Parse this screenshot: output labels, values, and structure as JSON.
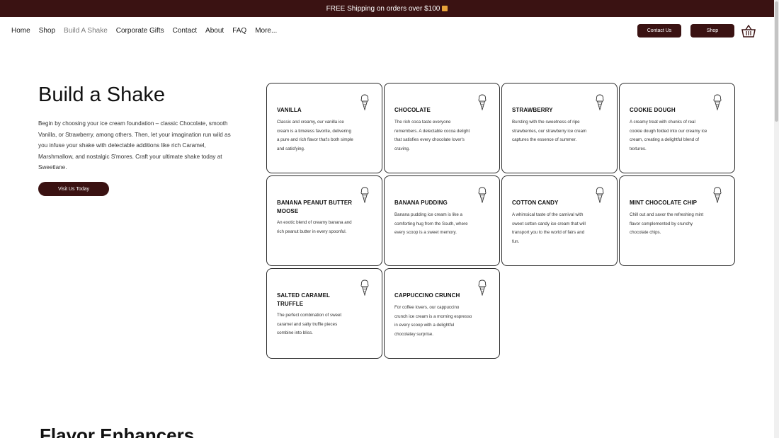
{
  "announcement": "FREE Shipping on orders over $100",
  "nav": {
    "items": [
      {
        "label": "Home",
        "active": false
      },
      {
        "label": "Shop",
        "active": false
      },
      {
        "label": "Build A Shake",
        "active": true
      },
      {
        "label": "Corporate Gifts",
        "active": false
      },
      {
        "label": "Contact",
        "active": false
      },
      {
        "label": "About",
        "active": false
      },
      {
        "label": "FAQ",
        "active": false
      },
      {
        "label": "More...",
        "active": false
      }
    ],
    "contact_label": "Contact Us",
    "shop_label": "Shop"
  },
  "hero": {
    "title": "Build a Shake",
    "text": "Begin by choosing your ice cream foundation – classic Chocolate, smooth Vanilla, or Strawberry, among others. Then, let your imagination run wild as you infuse your shake with delectable additions like rich Caramel, Marshmallow, and nostalgic S'mores. Craft your ultimate shake today at Sweetlane.",
    "button_label": "Visit Us Today"
  },
  "flavors": [
    {
      "title": "VANILLA",
      "desc": "Classic and creamy, our vanilla ice cream is a timeless favorite, delivering a pure and rich flavor that's both simple and satisfying."
    },
    {
      "title": "CHOCOLATE",
      "desc": "The rich coca taste everyone remembers. A delectable cocoa delight that satisfies every chocolate lover's craving."
    },
    {
      "title": "STRAWBERRY",
      "desc": "Bursting with the sweetness of ripe strawberries, our strawberry ice cream captures the essence of summer."
    },
    {
      "title": "COOKIE DOUGH",
      "desc": "A creamy treat with chunks of real cookie dough folded into our creamy ice cream, creating a delightful blend of textures."
    },
    {
      "title": "BANANA PEANUT BUTTER MOOSE",
      "desc": "An exotic blend of creamy banana and rich peanut butter in every spoonful."
    },
    {
      "title": "BANANA PUDDING",
      "desc": "Banana pudding ice cream is like a comforting hug from the South, where every scoop is a sweet memory."
    },
    {
      "title": "COTTON CANDY",
      "desc": "A whimsical taste of the carnival with sweet cotton candy ice cream that will transport you to the world of fairs and fun."
    },
    {
      "title": "MINT CHOCOLATE CHIP",
      "desc": "Chill out and savor the refreshing mint flavor complemented by crunchy chocolate chips."
    },
    {
      "title": "SALTED CARAMEL TRUFFLE",
      "desc": "The perfect combination of sweet caramel and salty truffle pieces combine into bliss."
    },
    {
      "title": "CAPPUCCINO CRUNCH",
      "desc": "For coffee lovers, our cappuccino crunch ice cream is a morning espresso in every scoop with a delightful chocolatey surprise."
    }
  ],
  "next_section_title": "Flavor Enhancers",
  "colors": {
    "brand": "#3a1212",
    "text": "#1a1a1a",
    "muted_nav": "#7a7a7a"
  },
  "icons": {
    "cart": "shopping-basket-icon",
    "cone": "ice-cream-cone-icon",
    "gift": "gift-icon"
  }
}
